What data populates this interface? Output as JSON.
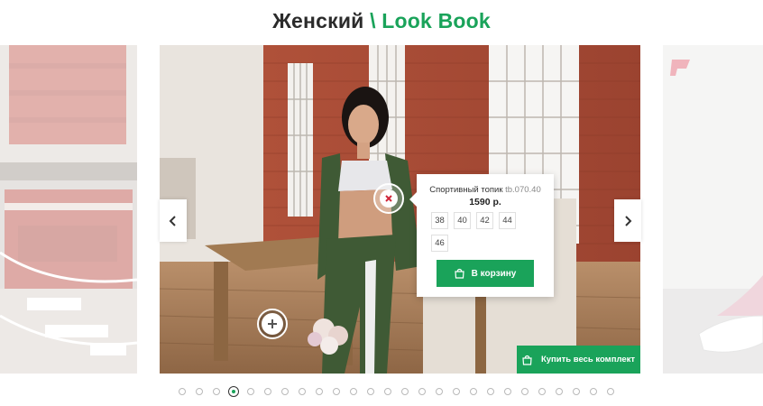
{
  "header": {
    "title_main": "Женский",
    "title_separator": "\\",
    "title_accent": "Look Book"
  },
  "slider": {
    "prev_icon": "chevron-left-icon",
    "next_icon": "chevron-right-icon",
    "slide_count": 26,
    "active_index": 3
  },
  "product_popup": {
    "name": "Спортивный топик",
    "sku": "tb.070.40",
    "price": "1590 р.",
    "sizes": [
      "38",
      "40",
      "42",
      "44",
      "46"
    ],
    "cart_label": "В корзину",
    "cart_icon": "shopping-bag-icon"
  },
  "buy_all": {
    "label": "Купить весь комплект",
    "icon": "shopping-bag-icon"
  },
  "colors": {
    "accent": "#1aa35a",
    "title": "#2b2b2b"
  }
}
